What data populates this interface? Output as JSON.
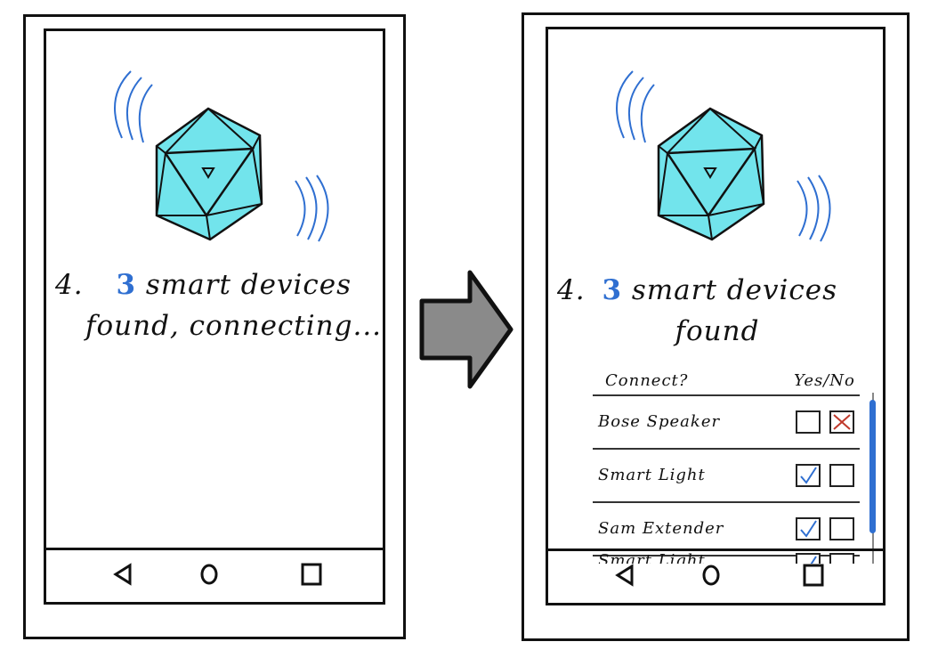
{
  "colors": {
    "accent": "#2f6fd1",
    "device": "#72e4ec",
    "arrow": "#8a8a8a",
    "reject": "#c0392b"
  },
  "left_screen": {
    "step": "4.",
    "count": "3",
    "line1_rest": "smart devices",
    "line2": "found, connecting..."
  },
  "right_screen": {
    "step": "4.",
    "count": "3",
    "line1_rest": "smart devices",
    "line2": "found",
    "list": {
      "header_question": "Connect?",
      "header_choice": "Yes/No",
      "items": [
        {
          "name": "Bose Speaker",
          "yes": false,
          "no": true
        },
        {
          "name": "Smart Light",
          "yes": true,
          "no": false
        },
        {
          "name": "Sam Extender",
          "yes": true,
          "no": false
        },
        {
          "name": "Smart Light",
          "yes": true,
          "no": false
        }
      ]
    }
  },
  "icons": {
    "device": "icosahedron-device-icon",
    "signal": "signal-wave-icon",
    "transition": "right-arrow-icon",
    "back": "back-triangle-icon",
    "home": "home-circle-icon",
    "recents": "recents-square-icon"
  }
}
